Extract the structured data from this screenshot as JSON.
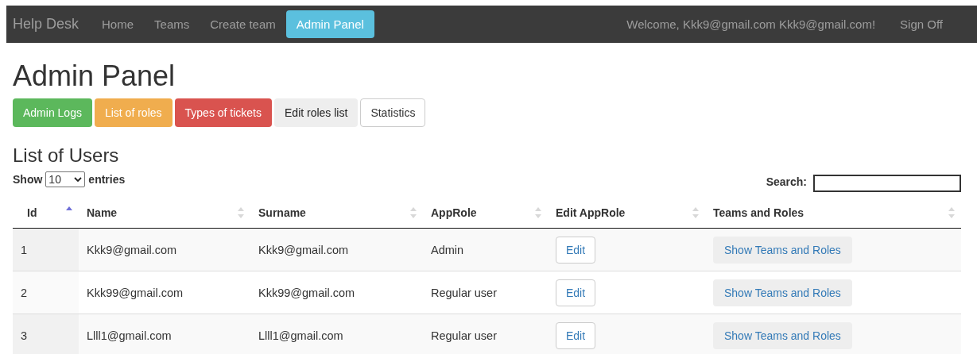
{
  "navbar": {
    "brand": "Help Desk",
    "items": [
      {
        "label": "Home",
        "selected": false
      },
      {
        "label": "Teams",
        "selected": false
      },
      {
        "label": "Create team",
        "selected": false
      },
      {
        "label": "Admin Panel",
        "selected": true
      }
    ],
    "welcome": "Welcome, Kkk9@gmail.com Kkk9@gmail.com!",
    "sign_off": "Sign Off"
  },
  "title": "Admin Panel",
  "admin_buttons": [
    {
      "label": "Admin Logs",
      "kind": "success"
    },
    {
      "label": "List of roles",
      "kind": "warning"
    },
    {
      "label": "Types of tickets",
      "kind": "danger"
    },
    {
      "label": "Edit roles list",
      "kind": "muted"
    },
    {
      "label": "Statistics",
      "kind": "default"
    }
  ],
  "section_title": "List of Users",
  "length": {
    "show": "Show",
    "value": "10",
    "entries": "entries"
  },
  "search": {
    "label": "Search:"
  },
  "table": {
    "columns": [
      {
        "label": "Id",
        "sorted": true
      },
      {
        "label": "Name",
        "sorted": false
      },
      {
        "label": "Surname",
        "sorted": false
      },
      {
        "label": "AppRole",
        "sorted": false
      },
      {
        "label": "Edit AppRole",
        "sorted": false
      },
      {
        "label": "Teams and Roles",
        "sorted": false
      }
    ],
    "rows": [
      {
        "id": "1",
        "name": "Kkk9@gmail.com",
        "surname": "Kkk9@gmail.com",
        "role": "Admin",
        "edit": "Edit",
        "teams": "Show Teams and Roles"
      },
      {
        "id": "2",
        "name": "Kkk99@gmail.com",
        "surname": "Kkk99@gmail.com",
        "role": "Regular user",
        "edit": "Edit",
        "teams": "Show Teams and Roles"
      },
      {
        "id": "3",
        "name": "Llll1@gmail.com",
        "surname": "Llll1@gmail.com",
        "role": "Regular user",
        "edit": "Edit",
        "teams": "Show Teams and Roles"
      }
    ]
  }
}
